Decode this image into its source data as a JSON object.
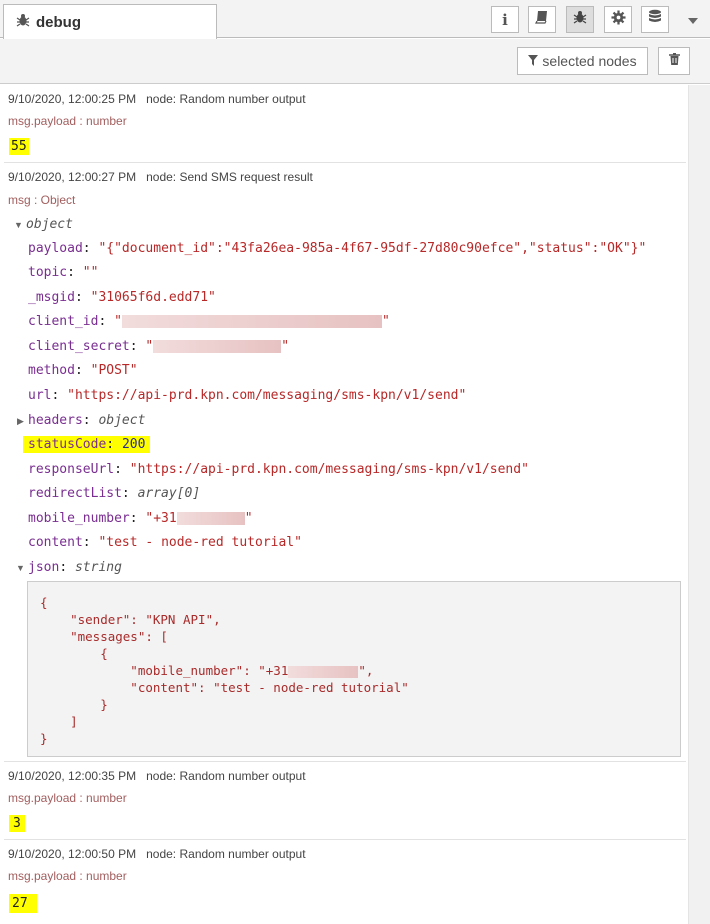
{
  "tab": {
    "icon": "bug-icon",
    "label": "debug"
  },
  "toolbar": {
    "buttons": [
      "info-icon",
      "book-icon",
      "bug-icon",
      "gear-icon",
      "database-icon"
    ],
    "filter_label": "selected nodes",
    "filter_icon": "filter-icon",
    "clear_icon": "trash-icon"
  },
  "messages": [
    {
      "time": "9/10/2020, 12:00:25 PM",
      "node": "node: Random number output",
      "topic": "msg.payload : number",
      "value": "55"
    },
    {
      "time": "9/10/2020, 12:00:27 PM",
      "node": "node: Send SMS request result",
      "topic": "msg : Object",
      "object_label": "object",
      "props": [
        {
          "key": "payload",
          "value": "\"{\"document_id\":\"43fa26ea-985a-4f67-95df-27d80c90efce\",\"status\":\"OK\"}\""
        },
        {
          "key": "topic",
          "value": "\"\""
        },
        {
          "key": "_msgid",
          "value": "\"31065f6d.edd71\""
        },
        {
          "key": "client_id",
          "value": "\"[redacted]\""
        },
        {
          "key": "client_secret",
          "value": "\"[redacted]\""
        },
        {
          "key": "method",
          "value": "\"POST\""
        },
        {
          "key": "url",
          "value": "\"https://api-prd.kpn.com/messaging/sms-kpn/v1/send\""
        },
        {
          "key": "headers",
          "value": "object"
        },
        {
          "key": "statusCode",
          "value": "200"
        },
        {
          "key": "responseUrl",
          "value": "\"https://api-prd.kpn.com/messaging/sms-kpn/v1/send\""
        },
        {
          "key": "redirectList",
          "value": "array[0]"
        },
        {
          "key": "mobile_number",
          "value": "\"+31"
        },
        {
          "key": "content",
          "value": "\"test - node-red tutorial\""
        },
        {
          "key": "json",
          "value": "string"
        }
      ],
      "json_text": [
        "{",
        "    \"sender\": \"KPN API\",",
        "    \"messages\": [",
        "        {",
        "            \"mobile_number\": \"+31",
        "            \"content\": \"test - node-red tutorial\"",
        "        }",
        "    ]",
        "}"
      ]
    },
    {
      "time": "9/10/2020, 12:00:35 PM",
      "node": "node: Random number output",
      "topic": "msg.payload : number",
      "value": "3"
    },
    {
      "time": "9/10/2020, 12:00:50 PM",
      "node": "node: Random number output",
      "topic": "msg.payload : number",
      "value": "27"
    }
  ],
  "colors": {
    "highlight": "#ffff00",
    "string": "#b72828",
    "key": "#792e90"
  }
}
